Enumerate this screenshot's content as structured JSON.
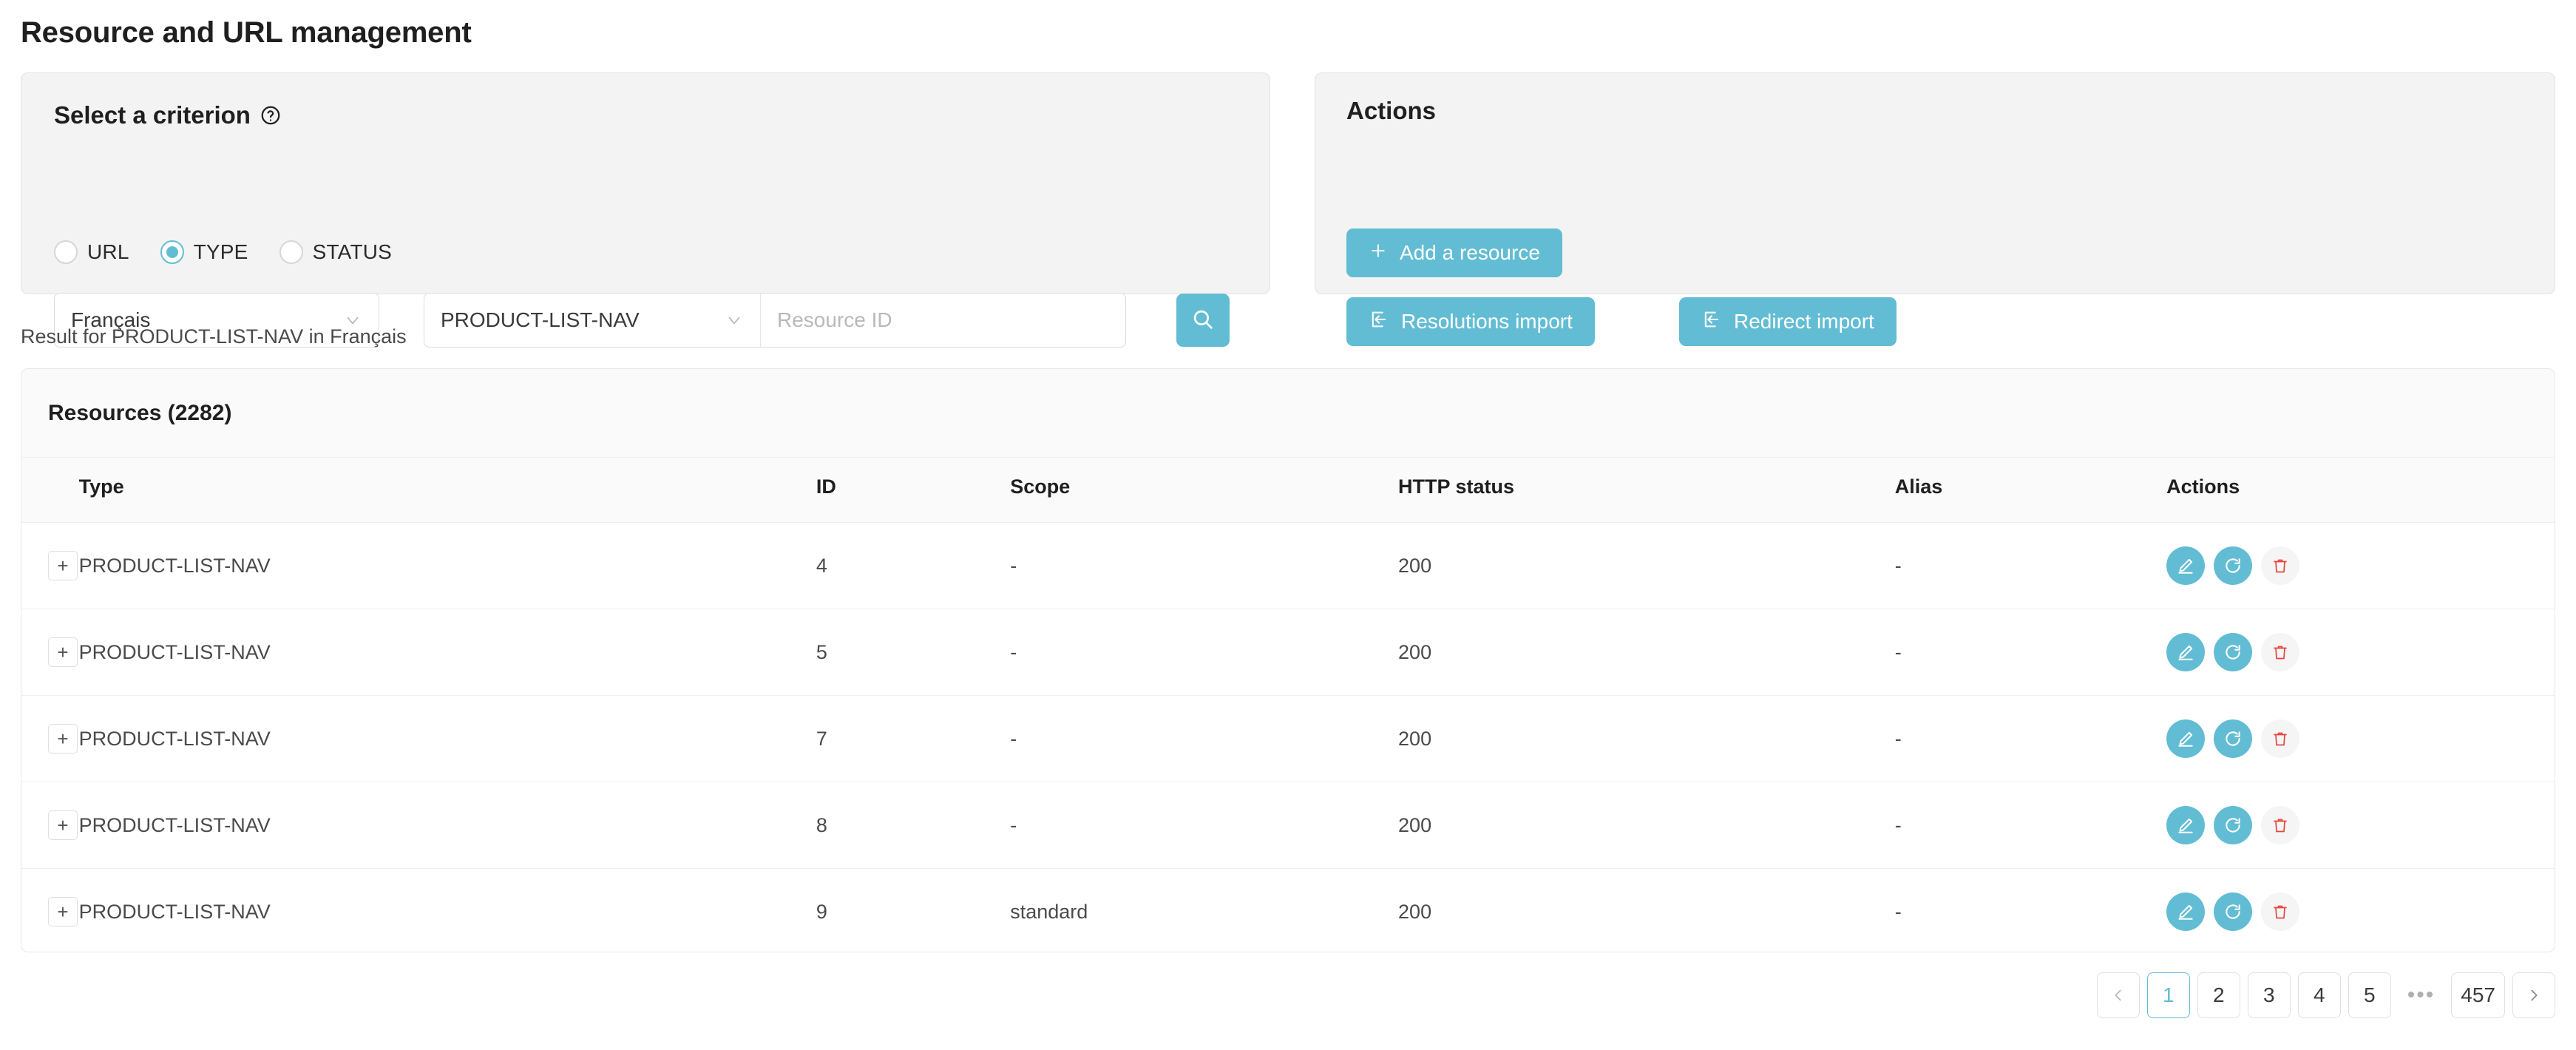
{
  "page": {
    "title": "Resource and URL management"
  },
  "criterion": {
    "heading": "Select a criterion",
    "help_icon": "question-circle-icon",
    "radios": [
      {
        "label": "URL",
        "checked": false
      },
      {
        "label": "TYPE",
        "checked": true
      },
      {
        "label": "STATUS",
        "checked": false
      }
    ],
    "language_select": {
      "value": "Français",
      "chevron_icon": "chevron-down-icon"
    },
    "type_select": {
      "value": "PRODUCT-LIST-NAV",
      "chevron_icon": "chevron-down-icon"
    },
    "resource_id_input": {
      "value": "",
      "placeholder": "Resource ID"
    },
    "search_button": {
      "icon": "search-icon",
      "label": ""
    }
  },
  "actions": {
    "title": "Actions",
    "add_resource": {
      "label": "Add a resource",
      "icon": "plus-icon"
    },
    "resolutions_import": {
      "label": "Resolutions import",
      "icon": "import-icon"
    },
    "redirect_import": {
      "label": "Redirect import",
      "icon": "import-icon"
    }
  },
  "result": {
    "caption": "Result for PRODUCT-LIST-NAV in Français",
    "card_title": "Resources (2282)",
    "columns": [
      "Type",
      "ID",
      "Scope",
      "HTTP status",
      "Alias",
      "Actions"
    ],
    "expand_label": "+",
    "row_actions": {
      "edit_icon": "pencil-edit-icon",
      "refresh_icon": "refresh-icon",
      "delete_icon": "trash-delete-icon"
    },
    "rows": [
      {
        "type": "PRODUCT-LIST-NAV",
        "id": "4",
        "scope": "-",
        "http_status": "200",
        "alias": "-"
      },
      {
        "type": "PRODUCT-LIST-NAV",
        "id": "5",
        "scope": "-",
        "http_status": "200",
        "alias": "-"
      },
      {
        "type": "PRODUCT-LIST-NAV",
        "id": "7",
        "scope": "-",
        "http_status": "200",
        "alias": "-"
      },
      {
        "type": "PRODUCT-LIST-NAV",
        "id": "8",
        "scope": "-",
        "http_status": "200",
        "alias": "-"
      },
      {
        "type": "PRODUCT-LIST-NAV",
        "id": "9",
        "scope": "standard",
        "http_status": "200",
        "alias": "-"
      }
    ]
  },
  "pagination": {
    "prev_icon": "chevron-left-icon",
    "next_icon": "chevron-right-icon",
    "pages": [
      "1",
      "2",
      "3",
      "4",
      "5"
    ],
    "ellipsis": "•••",
    "last_page": "457",
    "active_page": "1"
  },
  "colors": {
    "accent": "#62bdd4",
    "danger": "#e8453c",
    "card_bg": "#f3f3f3",
    "table_head_bg": "#fafafa"
  }
}
